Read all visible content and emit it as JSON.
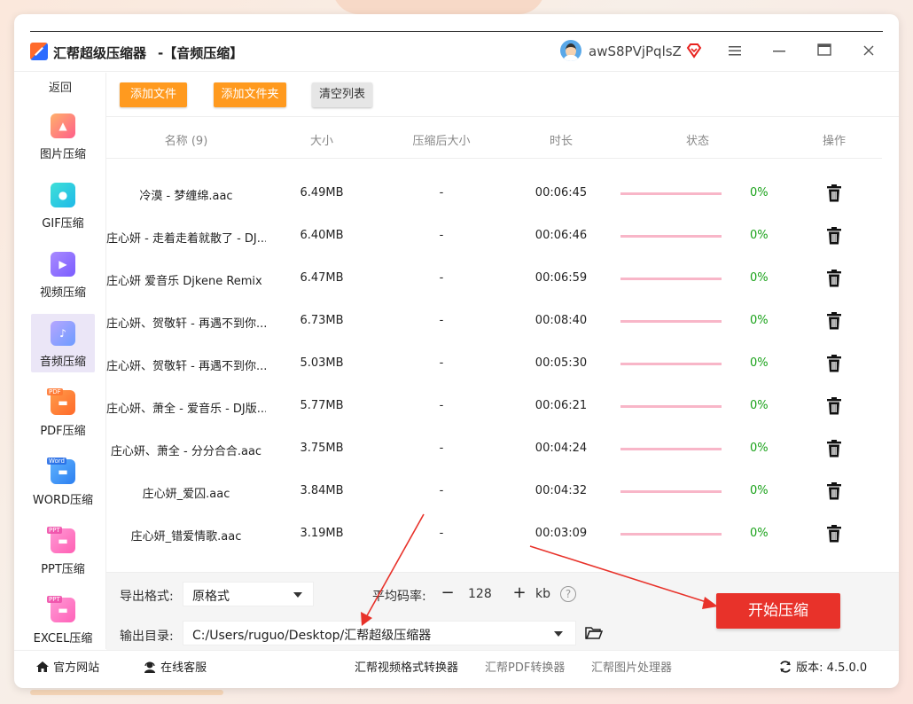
{
  "window": {
    "app_title": "汇帮超级压缩器",
    "sub_title": "-【音频压缩】",
    "username": "awS8PVjPqlsZ"
  },
  "sidebar": {
    "back_label": "返回",
    "items": [
      {
        "label": "图片压缩",
        "icon": "image-icon"
      },
      {
        "label": "GIF压缩",
        "icon": "gif-icon"
      },
      {
        "label": "视频压缩",
        "icon": "video-icon"
      },
      {
        "label": "音频压缩",
        "icon": "audio-icon",
        "active": true
      },
      {
        "label": "PDF压缩",
        "icon": "pdf-icon",
        "tag": "PDF"
      },
      {
        "label": "WORD压缩",
        "icon": "word-icon",
        "tag": "Word"
      },
      {
        "label": "PPT压缩",
        "icon": "ppt-icon",
        "tag": "PPT"
      },
      {
        "label": "EXCEL压缩",
        "icon": "excel-icon",
        "tag": "PPT"
      }
    ]
  },
  "toolbar": {
    "add_file": "添加文件",
    "add_folder": "添加文件夹",
    "clear_list": "清空列表"
  },
  "table": {
    "headers": {
      "name": "名称 (9)",
      "size": "大小",
      "compressed_size": "压缩后大小",
      "duration": "时长",
      "status": "状态",
      "action": "操作"
    },
    "rows": [
      {
        "name": "冷漠 - 梦缠绵.aac",
        "size": "6.49MB",
        "compressed": "-",
        "duration": "00:06:45",
        "progress": "0%"
      },
      {
        "name": "庄心妍 - 走着走着就散了 - DJ...",
        "size": "6.40MB",
        "compressed": "-",
        "duration": "00:06:46",
        "progress": "0%"
      },
      {
        "name": "庄心妍 爱音乐 Djkene Remix ...",
        "size": "6.47MB",
        "compressed": "-",
        "duration": "00:06:59",
        "progress": "0%"
      },
      {
        "name": "庄心妍、贺敬轩 - 再遇不到你...",
        "size": "6.73MB",
        "compressed": "-",
        "duration": "00:08:40",
        "progress": "0%"
      },
      {
        "name": "庄心妍、贺敬轩 - 再遇不到你...",
        "size": "5.03MB",
        "compressed": "-",
        "duration": "00:05:30",
        "progress": "0%"
      },
      {
        "name": "庄心妍、萧全 - 爱音乐 - DJ版...",
        "size": "5.77MB",
        "compressed": "-",
        "duration": "00:06:21",
        "progress": "0%"
      },
      {
        "name": "庄心妍、萧全 - 分分合合.aac",
        "size": "3.75MB",
        "compressed": "-",
        "duration": "00:04:24",
        "progress": "0%"
      },
      {
        "name": "庄心妍_爱囚.aac",
        "size": "3.84MB",
        "compressed": "-",
        "duration": "00:04:32",
        "progress": "0%"
      },
      {
        "name": "庄心妍_错爱情歌.aac",
        "size": "3.19MB",
        "compressed": "-",
        "duration": "00:03:09",
        "progress": "0%"
      }
    ]
  },
  "settings": {
    "format_label": "导出格式:",
    "format_value": "原格式",
    "bitrate_label": "平均码率:",
    "bitrate_value": "128",
    "bitrate_unit": "kb",
    "minus": "−",
    "plus": "+",
    "help": "?",
    "output_label": "输出目录:",
    "output_path": "C:/Users/ruguo/Desktop/汇帮超级压缩器",
    "start_button": "开始压缩"
  },
  "footer": {
    "website": "官方网站",
    "support": "在线客服",
    "link1": "汇帮视频格式转换器",
    "link2": "汇帮PDF转换器",
    "link3": "汇帮图片处理器",
    "version_label": "版本:",
    "version_value": "4.5.0.0"
  },
  "colors": {
    "accent_orange": "#ff9a1f",
    "start_red": "#e8322a",
    "progress_pink": "#f8b6c8",
    "percent_green": "#1aa21a",
    "active_bg": "#ebe6f7"
  }
}
